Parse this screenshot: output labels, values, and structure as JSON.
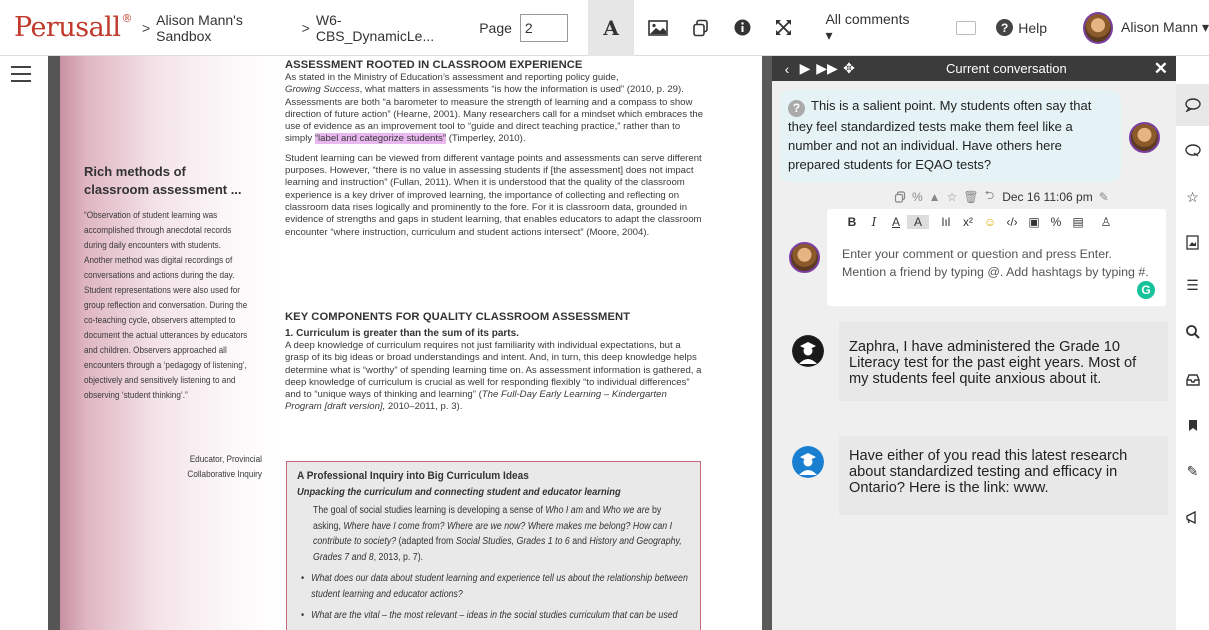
{
  "topbar": {
    "logo": "Perusall",
    "logo_mark": "®",
    "breadcrumb_sep_1": ">",
    "breadcrumb_course": "Alison Mann's Sandbox",
    "breadcrumb_sep_2": ">",
    "breadcrumb_doc": "W6- CBS_DynamicLe...",
    "page_label": "Page",
    "page_value": "2",
    "comments_filter": "All comments ▾",
    "help_label": "Help",
    "user_name": "Alison Mann ▾"
  },
  "document": {
    "sidebar": {
      "title": "Rich methods of classroom assessment ...",
      "quote": "“Observation of student learning was accomplished through anecdotal records during daily encounters with students. Another method was digital recordings of conversations and actions during the day. Student representations were also used for group reflection and conversation. During the co-teaching cycle, observers attempted to document the actual utterances by educators and children. Observers approached all encounters through a ‘pedagogy of listening’, objectively and sensitively listening to and observing ‘student thinking’.”",
      "attribution_1": "Educator, Provincial",
      "attribution_2": "Collaborative Inquiry"
    },
    "section1_heading": "ASSESSMENT ROOTED IN CLASSROOM EXPERIENCE",
    "p1_a": "As stated in the Ministry of Education’s assessment and reporting policy guide,",
    "p1_b_italic": "Growing Success",
    "p1_b": ", what matters in assessments “is how the information is used” (2010, p. 29). Assessments are both “a barometer to measure the strength of learning and a compass to show direction of future action” (Hearne, 2001). Many researchers call for a mindset which embraces the use of evidence as an improvement tool to “guide and direct teaching practice,” rather than to simply",
    "p1_highlight": "“label and categorize students”",
    "p1_c": " (Timperley, 2010).",
    "p2": "Student learning can be viewed from different vantage points and assessments can serve different purposes. However, “there is no value in assessing students if [the assessment] does not impact learning and instruction” (Fullan, 2011). When it is understood that the quality of the classroom experience is a key driver of improved learning, the importance of collecting and reflecting on classroom data rises logically and prominently to the fore. For it is classroom data, grounded in evidence of strengths and gaps in student learning, that enables educators to adapt the classroom encounter “where instruction, curriculum and student actions intersect” (Moore, 2004).",
    "section2_heading": "KEY COMPONENTS FOR QUALITY CLASSROOM ASSESSMENT",
    "sub1": "1. Curriculum is greater than the sum of its parts.",
    "p3_a": "A deep knowledge of curriculum requires not just familiarity with individual expectations, but a grasp of its big ideas or broad understandings and intent. And, in turn, this deep knowledge helps determine what is “worthy” of spending learning time on. As assessment information is gathered, a deep knowledge of curriculum is crucial as well for responding flexibly “to individual differences” and to “unique ways of thinking and learning” (",
    "p3_italic": "The Full-Day Early Learning – Kindergarten Program [draft version],",
    "p3_b": " 2010–2011, p. 3).",
    "inquiry": {
      "title": "A Professional Inquiry into Big Curriculum Ideas",
      "subtitle": "Unpacking the curriculum and connecting student and educator learning",
      "para_a": "The goal of social studies learning is developing a sense of ",
      "para_i1": "Who I am",
      "para_b": " and ",
      "para_i2": "Who we are",
      "para_c": " by asking, ",
      "para_i3": "Where have I come from? Where are we now? Where makes me belong? How can I contribute to society?",
      "para_d": " (adapted from ",
      "para_i4": "Social Studies, Grades 1 to 6",
      "para_e": " and ",
      "para_i5": "History and Geography, Grades 7 and 8",
      "para_f": ", 2013, p. 7).",
      "bullet_1": "What does our data about student learning and experience tell us about the relationship between student learning and educator actions?",
      "bullet_2": "What are the vital – the most relevant – ideas in the social studies curriculum that can be used"
    }
  },
  "conversation": {
    "header_title": "Current conversation",
    "close": "✕",
    "nav": [
      "‹",
      "▶",
      "▶▶",
      "✥"
    ],
    "comment_text": "This is a salient point. My students often say that they feel standardized tests make them feel like a number and not an individual. Have others here prepared students for EQAO tests?",
    "comment_time": "Dec 16 11:06 pm",
    "editor_toolbar": [
      "B",
      "I",
      "A",
      "A",
      "lıl",
      "x²",
      "☺",
      "‹/›",
      "▣",
      "%",
      "▤",
      "♙"
    ],
    "editor_placeholder": "Enter your comment or question and press Enter. Mention a friend by typing @. Add hashtags by typing #.",
    "grammarly": "G",
    "replies": [
      {
        "text": "Zaphra, I have administered the Grade 10 Literacy test for the past eight years. Most of my students feel quite anxious about it."
      },
      {
        "text": "Have either of you read this latest research about standardized testing and efficacy in Ontario? Here is the link: www."
      }
    ]
  },
  "colors": {
    "brand": "#c0392b",
    "highlight": "#e9b8ef",
    "bubble": "#e5f3f6",
    "avatar_ring": "#7b3fa0",
    "student_dark": "#1a1a1a",
    "student_blue": "#1a7fd0",
    "grammarly": "#15c39a"
  }
}
